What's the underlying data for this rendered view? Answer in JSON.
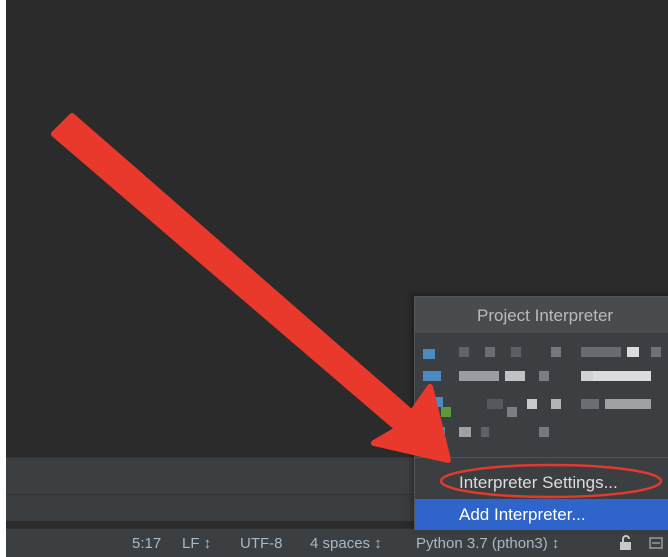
{
  "status_bar": {
    "caret_position": "5:17",
    "line_separator": "LF ↕",
    "encoding": "UTF-8",
    "indent": "4 spaces ↕",
    "interpreter": "Python 3.7 (pthon3) ↕"
  },
  "interpreter_popup": {
    "title": "Project Interpreter",
    "menu": {
      "settings_label": "Interpreter Settings...",
      "add_label": "Add Interpreter..."
    }
  },
  "colors": {
    "editor_bg": "#2b2b2b",
    "panel_bg": "#3c3f41",
    "selection": "#2f65ca",
    "annotation_red": "#e8392c"
  },
  "icons": [
    "lock-icon",
    "settings-icon"
  ]
}
